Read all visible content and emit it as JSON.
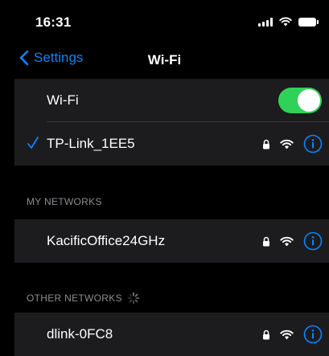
{
  "status_bar": {
    "time": "16:31",
    "icons": [
      "cellular-signal-icon",
      "wifi-status-icon",
      "battery-icon"
    ]
  },
  "nav": {
    "back_label": "Settings",
    "title": "Wi-Fi"
  },
  "wifi_toggle": {
    "label": "Wi-Fi",
    "on": true
  },
  "connected_network": {
    "name": "TP-Link_1EE5",
    "secured": true,
    "connected": true
  },
  "my_networks": {
    "header": "MY NETWORKS",
    "items": [
      {
        "name": "KacificOffice24GHz",
        "secured": true
      }
    ]
  },
  "other_networks": {
    "header": "OTHER NETWORKS",
    "scanning": true,
    "items": [
      {
        "name": "dlink-0FC8",
        "secured": true
      }
    ]
  },
  "colors": {
    "background": "#000000",
    "group_background": "#1c1c1e",
    "accent_blue": "#0a84ff",
    "toggle_green": "#30d158",
    "secondary_text": "#8d8d93",
    "separator": "#38383a"
  }
}
